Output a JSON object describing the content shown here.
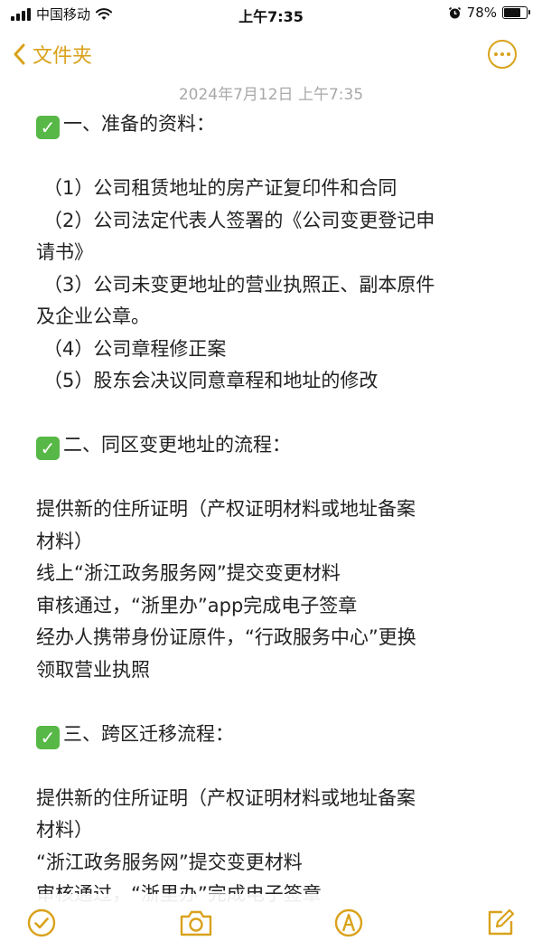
{
  "status_bar": {
    "carrier": "中国移动",
    "time": "上午7:35",
    "battery_percent": "78%",
    "battery_level": 0.78
  },
  "nav": {
    "back_label": "文件夹",
    "back_icon": "chevron-left-icon",
    "more_icon": "ellipsis-circle-icon",
    "accent_color": "#d9a21b"
  },
  "note": {
    "timestamp": "2024年7月12日 上午7:35",
    "sections": [
      {
        "heading": "一、准备的资料：",
        "lines": [
          "（1）公司租赁地址的房产证复印件和合同",
          "（2）公司法定代表人签署的《公司变更登记申",
          "请书》",
          "（3）公司未变更地址的营业执照正、副本原件",
          "及企业公章。",
          "（4）公司章程修正案",
          "（5）股东会决议同意章程和地址的修改"
        ]
      },
      {
        "heading": "二、同区变更地址的流程：",
        "lines": [
          "提供新的住所证明（产权证明材料或地址备案",
          "材料）",
          "线上“浙江政务服务网”提交变更材料",
          "审核通过，“浙里办”app完成电子签章",
          "经办人携带身份证原件，“行政服务中心”更换",
          "领取营业执照"
        ]
      },
      {
        "heading": "三、跨区迁移流程：",
        "lines": [
          "提供新的住所证明（产权证明材料或地址备案",
          "材料）",
          "“浙江政务服务网”提交变更材料",
          "审核通过，“浙里办”完成电子签章"
        ]
      }
    ],
    "check_icon": "green-checkbox-icon",
    "check_color": "#58b847"
  },
  "toolbar": {
    "icons": [
      "checklist-icon",
      "camera-icon",
      "markup-pen-icon",
      "compose-icon"
    ]
  }
}
